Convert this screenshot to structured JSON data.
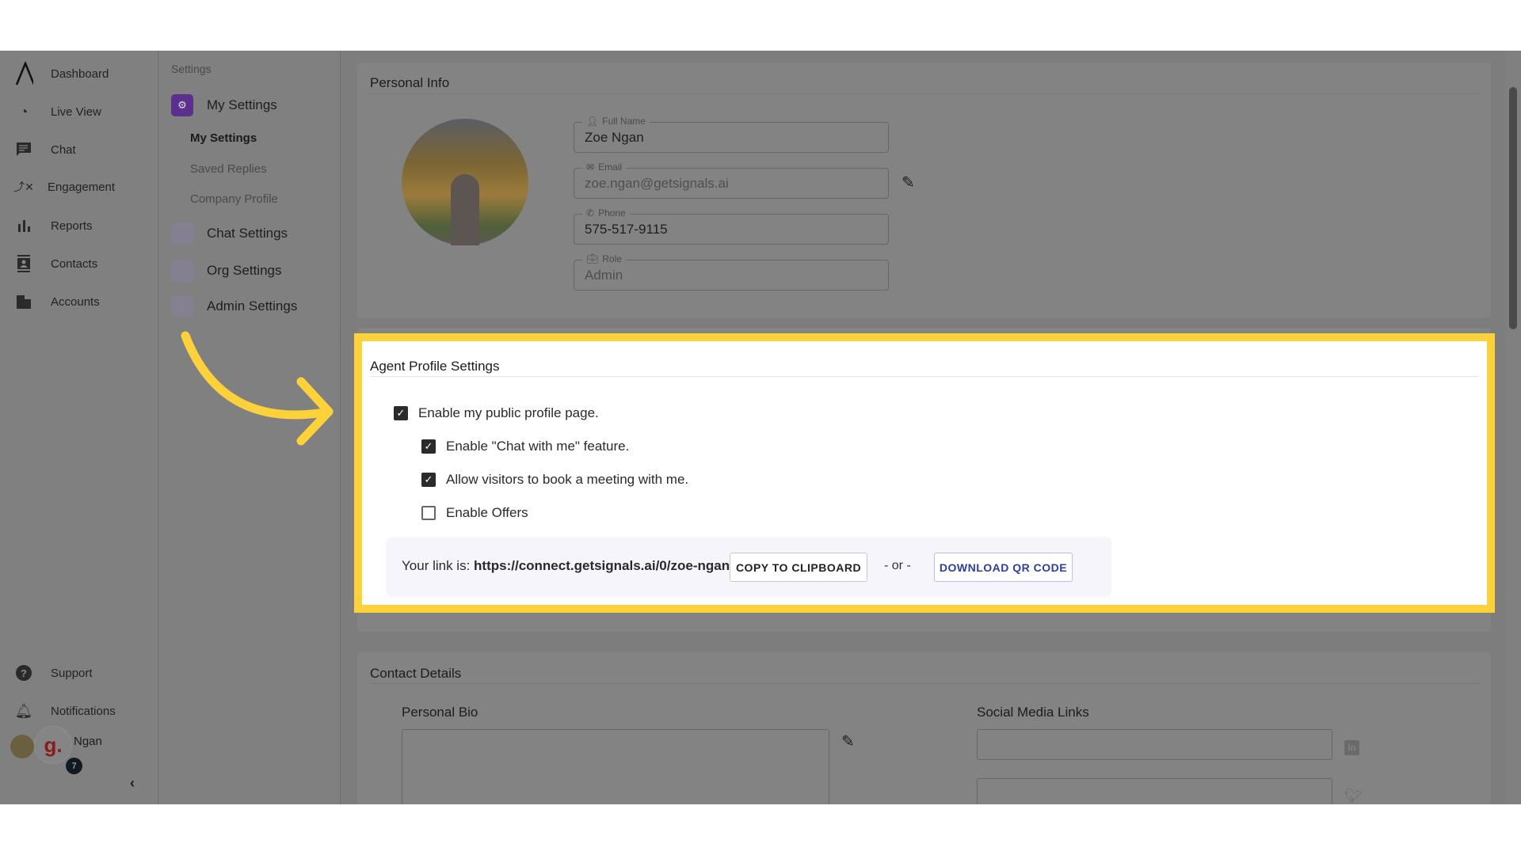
{
  "nav": {
    "items": [
      {
        "label": "Dashboard",
        "icon": "logo-icon"
      },
      {
        "label": "Live View",
        "icon": "live-view-icon"
      },
      {
        "label": "Chat",
        "icon": "chat-icon"
      },
      {
        "label": "Engagement",
        "icon": "engagement-icon"
      },
      {
        "label": "Reports",
        "icon": "reports-icon"
      },
      {
        "label": "Contacts",
        "icon": "contacts-icon"
      },
      {
        "label": "Accounts",
        "icon": "accounts-icon"
      }
    ],
    "support": "Support",
    "notifications": "Notifications",
    "user_name": "Ngan",
    "badge": "7",
    "avatar_letter": "g."
  },
  "subnav": {
    "heading": "Settings",
    "my_settings": "My Settings",
    "children": [
      "My Settings",
      "Saved Replies",
      "Company Profile"
    ],
    "chat_settings": "Chat Settings",
    "org_settings": "Org Settings",
    "admin_settings": "Admin Settings"
  },
  "personal": {
    "title": "Personal Info",
    "full_name_label": "Full Name",
    "full_name": "Zoe Ngan",
    "email_label": "Email",
    "email": "zoe.ngan@getsignals.ai",
    "phone_label": "Phone",
    "phone": "575-517-9115",
    "role_label": "Role",
    "role": "Admin"
  },
  "agent": {
    "title": "Agent Profile Settings",
    "options": [
      {
        "label": "Enable my public profile page.",
        "checked": true
      },
      {
        "label": "Enable \"Chat with me\" feature.",
        "checked": true
      },
      {
        "label": "Allow visitors to book a meeting with me.",
        "checked": true
      },
      {
        "label": "Enable Offers",
        "checked": false
      }
    ],
    "link_prefix": "Your link is:",
    "link": "https://connect.getsignals.ai/0/zoe-ngan",
    "copy_label": "COPY TO CLIPBOARD",
    "or": "- or -",
    "download_label": "DOWNLOAD QR CODE"
  },
  "contact": {
    "title": "Contact Details",
    "bio_label": "Personal Bio",
    "social_label": "Social Media Links"
  },
  "colors": {
    "highlight": "#fdd13a",
    "brand_purple": "#5b2f8e",
    "download_text": "#2f3e9e"
  }
}
